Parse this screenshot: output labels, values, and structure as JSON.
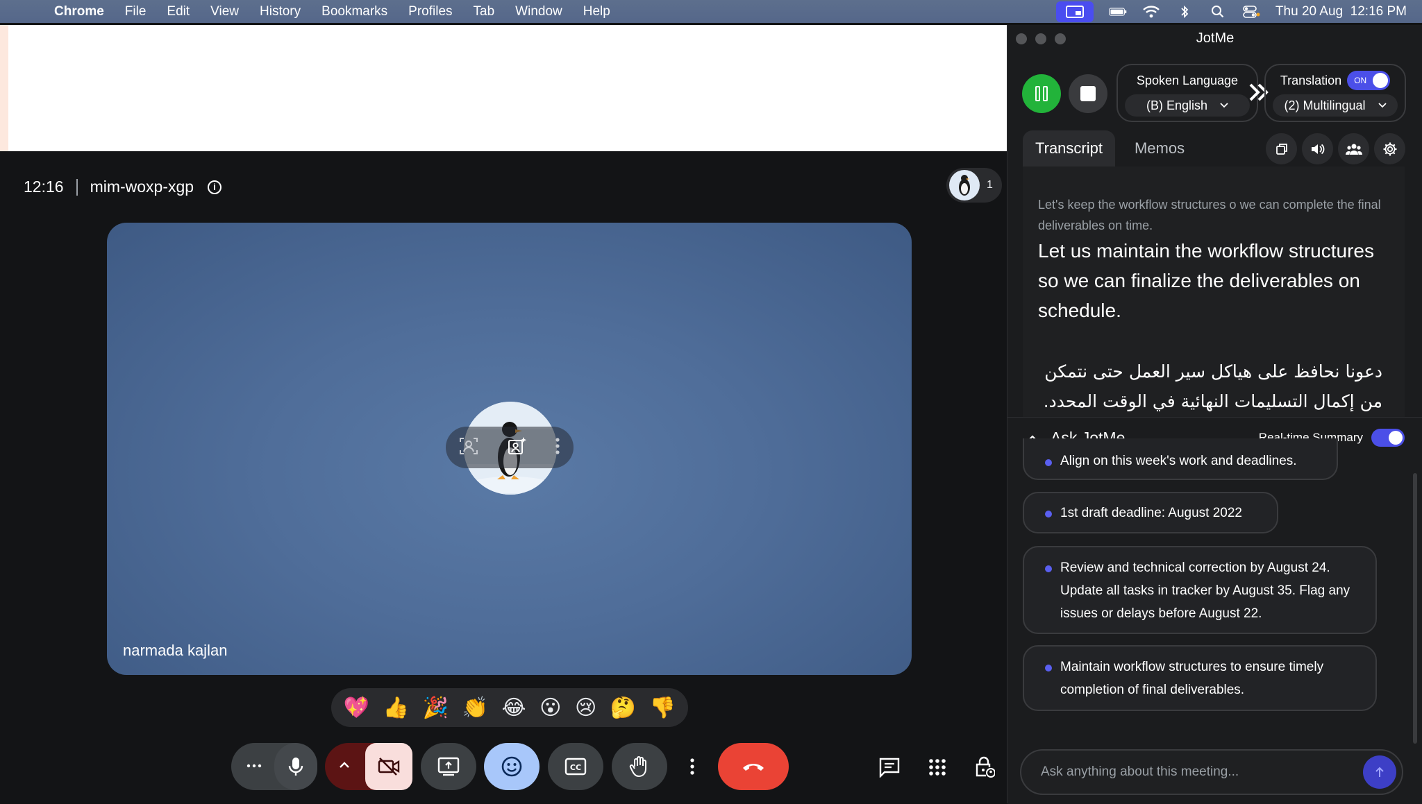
{
  "menubar": {
    "app": "Chrome",
    "items": [
      "File",
      "Edit",
      "View",
      "History",
      "Bookmarks",
      "Profiles",
      "Tab",
      "Window",
      "Help"
    ],
    "datetime": "Thu 20 Aug  12:16 PM"
  },
  "meet": {
    "time": "12:16",
    "code": "mim-woxp-xgp",
    "participant_count": "1",
    "participant_name": "narmada kajlan",
    "reactions": [
      "💖",
      "👍",
      "🎉",
      "👏",
      "😂",
      "😮",
      "😢",
      "🤔",
      "👎"
    ]
  },
  "jotme": {
    "title": "JotMe",
    "spoken_language_label": "Spoken Language",
    "spoken_language_value": "(B) English",
    "translation_label": "Translation",
    "translation_toggle": "ON",
    "translation_value": "(2) Multilingual",
    "tabs": [
      "Transcript",
      "Memos"
    ],
    "transcript": {
      "source": "Let's keep the workflow structures o we can complete the final deliverables on time.",
      "english": "Let us maintain the workflow structures so we can finalize the deliverables on schedule.",
      "arabic": "دعونا نحافظ على هياكل سير العمل حتى نتمكن من إكمال التسليمات النهائية في الوقت المحدد."
    },
    "ask": {
      "title": "Ask JotMe",
      "summary_label": "Real-time Summary",
      "items": [
        "Align on this week's work and deadlines.",
        "1st draft deadline: August 2022",
        "Review and technical correction by August 24. Update all tasks in tracker by August 35. Flag any issues or delays before August 22.",
        "Maintain workflow structures to ensure timely completion of final deliverables."
      ],
      "placeholder": "Ask anything about this meeting..."
    }
  },
  "colors": {
    "accent": "#4b4fe8",
    "play": "#22b33a",
    "end_call": "#ea4335"
  }
}
